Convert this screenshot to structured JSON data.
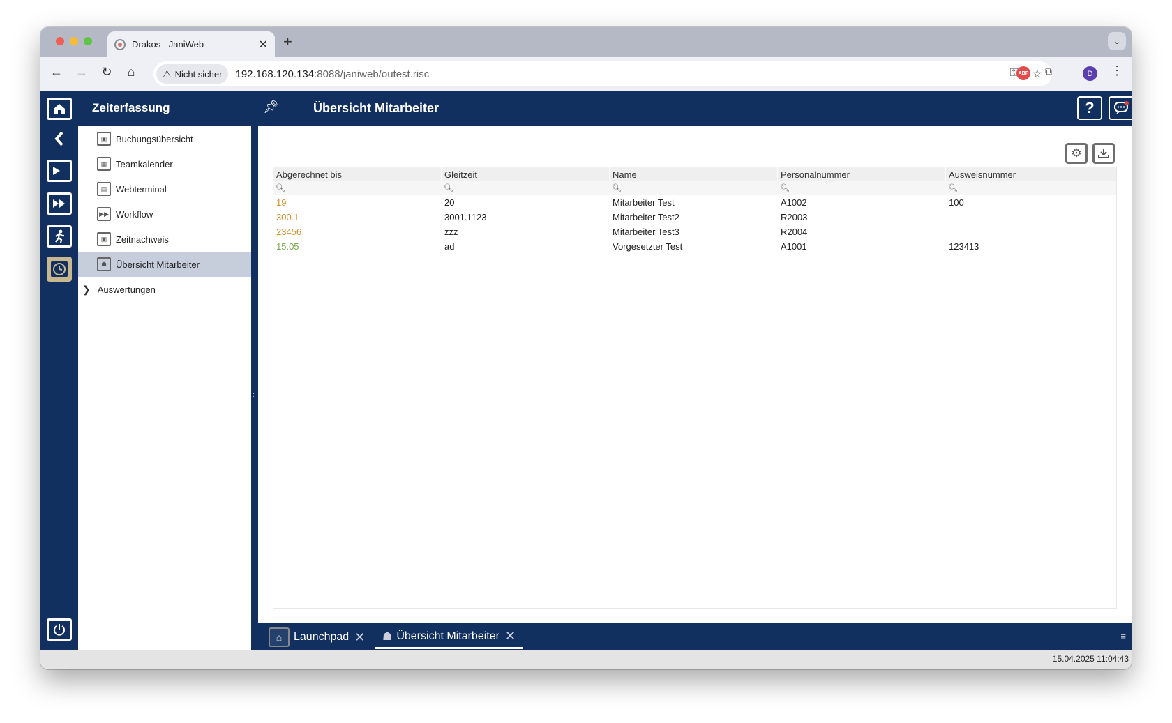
{
  "browser": {
    "tab_title": "Drakos - JaniWeb",
    "tab_close": "✕",
    "new_tab": "+",
    "security_chip": "Nicht sicher",
    "url_host": "192.168.120.134",
    "url_rest": ":8088/janiweb/outest.risc",
    "profile_initial": "D",
    "abp_label": "ABP"
  },
  "sidebar": {
    "title": "Zeiterfassung",
    "items": [
      {
        "label": "Buchungsübersicht",
        "icon": "booking-icon"
      },
      {
        "label": "Teamkalender",
        "icon": "calendar-icon"
      },
      {
        "label": "Webterminal",
        "icon": "terminal-icon"
      },
      {
        "label": "Workflow",
        "icon": "workflow-icon"
      },
      {
        "label": "Zeitnachweis",
        "icon": "timesheet-icon"
      },
      {
        "label": "Übersicht Mitarbeiter",
        "icon": "employee-overview-icon",
        "selected": true
      }
    ],
    "group": {
      "label": "Auswertungen",
      "expanded": false
    }
  },
  "main": {
    "title": "Übersicht Mitarbeiter",
    "table": {
      "columns": [
        "Abgerechnet bis",
        "Gleitzeit",
        "Name",
        "Personalnummer",
        "Ausweisnummer"
      ],
      "rows": [
        [
          "19",
          "20",
          "Mitarbeiter Test",
          "A1002",
          "100"
        ],
        [
          "300.1",
          "3001.1123",
          "Mitarbeiter Test2",
          "R2003",
          ""
        ],
        [
          "23456",
          "zzz",
          "Mitarbeiter Test3",
          "R2004",
          ""
        ],
        [
          "15.05",
          "ad",
          "Vorgesetzter Test",
          "A1001",
          "123413"
        ]
      ]
    }
  },
  "tabs": [
    {
      "label": "Launchpad",
      "active": false
    },
    {
      "label": "Übersicht Mitarbeiter",
      "active": true
    }
  ],
  "status": {
    "datetime": "15.04.2025 11:04:43"
  },
  "colors": {
    "app_bg": "#12305f",
    "selection": "#c6cedb",
    "link_orange": "#d1912e",
    "link_green": "#7aa84a",
    "active_rail": "#c9b88f"
  }
}
